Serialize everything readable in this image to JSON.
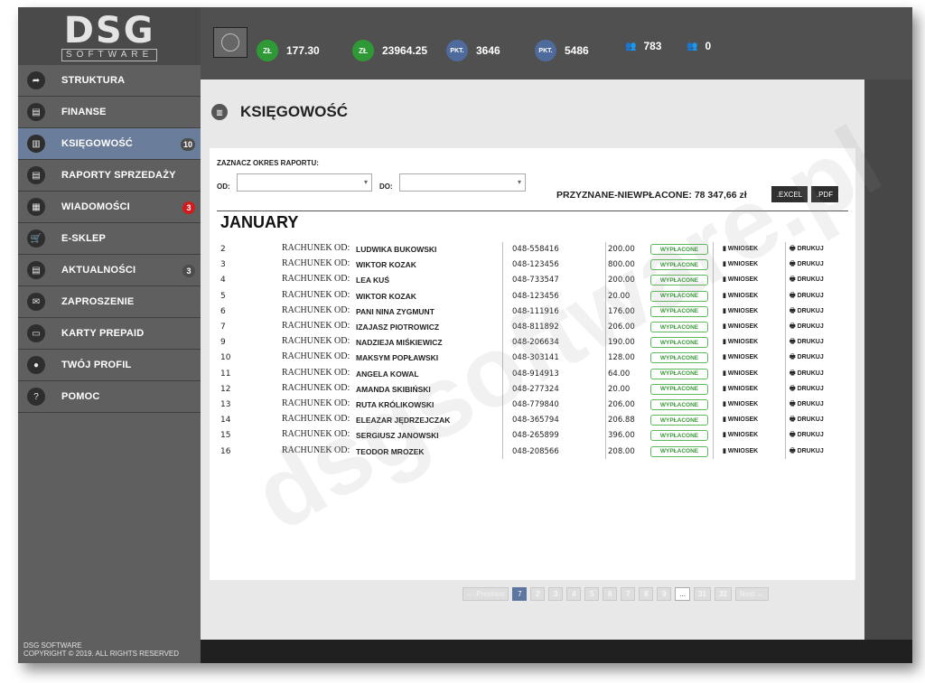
{
  "brand": {
    "name": "DSG",
    "sub": "SOFTWARE"
  },
  "sidebar": {
    "items": [
      {
        "label": "STRUKTURA",
        "icon": "arrow-icon",
        "glyph": "➦"
      },
      {
        "label": "FINANSE",
        "icon": "document-icon",
        "glyph": "▤"
      },
      {
        "label": "KSIĘGOWOŚĆ",
        "icon": "chart-bars-icon",
        "glyph": "▥",
        "badge": "10",
        "active": true
      },
      {
        "label": "RAPORTY SPRZEDAŻY",
        "icon": "report-icon",
        "glyph": "▤"
      },
      {
        "label": "WIADOMOŚCI",
        "icon": "message-icon",
        "glyph": "▦",
        "badge": "3",
        "badge_color": "red"
      },
      {
        "label": "E-SKLEP",
        "icon": "cart-icon",
        "glyph": "🛒"
      },
      {
        "label": "AKTUALNOŚCI",
        "icon": "news-icon",
        "glyph": "▤",
        "badge": "3"
      },
      {
        "label": "ZAPROSZENIE",
        "icon": "invite-icon",
        "glyph": "✉"
      },
      {
        "label": "KARTY PREPAID",
        "icon": "card-icon",
        "glyph": "▭"
      },
      {
        "label": "TWÓJ PROFIL",
        "icon": "profile-icon",
        "glyph": "●"
      },
      {
        "label": "POMOC",
        "icon": "help-icon",
        "glyph": "?"
      }
    ],
    "footer_line1": "DSG SOFTWARE",
    "footer_line2": "COPYRIGHT © 2019. ALL RIGHTS RESERVED"
  },
  "topbar": {
    "stats": [
      {
        "currency": "ZŁ",
        "value": "177.30"
      },
      {
        "currency": "ZŁ",
        "value": "23964.25"
      },
      {
        "currency": "PKT.",
        "value": "3646"
      },
      {
        "currency": "PKT.",
        "value": "5486"
      },
      {
        "people": "👥",
        "value": "783"
      },
      {
        "people": "👥",
        "value": "0"
      }
    ]
  },
  "page": {
    "title": "KSIĘGOWOŚĆ",
    "period_label": "ZAZNACZ OKRES RAPORTU:",
    "od_label": "OD:",
    "do_label": "DO:",
    "summary": "PRZYZNANE-NIEWPŁACONE: 78 347,66 zł",
    "excel_label": ".EXCEL",
    "pdf_label": ".PDF",
    "month": "JANUARY",
    "colors": {
      "accent": "#5d76a0",
      "status_green": "#5cb85c"
    }
  },
  "table": {
    "prefix": "RACHUNEK OD:",
    "status_label": "WYPŁACONE",
    "wniosek_label": "WNIOSEK",
    "drukuj_label": "DRUKUJ",
    "rows": [
      {
        "no": "2",
        "name": "LUDWIKA BUKOWSKI",
        "tel": "048-558416",
        "amount": "200.00"
      },
      {
        "no": "3",
        "name": "WIKTOR KOZAK",
        "tel": "048-123456",
        "amount": "800.00"
      },
      {
        "no": "4",
        "name": "LEA KUŚ",
        "tel": "048-733547",
        "amount": "200.00"
      },
      {
        "no": "5",
        "name": "WIKTOR KOZAK",
        "tel": "048-123456",
        "amount": "20.00"
      },
      {
        "no": "6",
        "name": "PANI NINA ZYGMUNT",
        "tel": "048-111916",
        "amount": "176.00"
      },
      {
        "no": "7",
        "name": "IZAJASZ PIOTROWICZ",
        "tel": "048-811892",
        "amount": "206.00"
      },
      {
        "no": "9",
        "name": "NADZIEJA MIŚKIEWICZ",
        "tel": "048-206634",
        "amount": "190.00"
      },
      {
        "no": "10",
        "name": "MAKSYM POPŁAWSKI",
        "tel": "048-303141",
        "amount": "128.00"
      },
      {
        "no": "11",
        "name": "ANGELA KOWAL",
        "tel": "048-914913",
        "amount": "64.00"
      },
      {
        "no": "12",
        "name": "AMANDA SKIBIŃSKI",
        "tel": "048-277324",
        "amount": "20.00"
      },
      {
        "no": "13",
        "name": "RUTA KRÓLIKOWSKI",
        "tel": "048-779840",
        "amount": "206.00"
      },
      {
        "no": "14",
        "name": "ELEAZAR JĘDRZEJCZAK",
        "tel": "048-365794",
        "amount": "206.88"
      },
      {
        "no": "15",
        "name": "SERGIUSZ JANOWSKI",
        "tel": "048-265899",
        "amount": "396.00"
      },
      {
        "no": "16",
        "name": "TEODOR MROZEK",
        "tel": "048-208566",
        "amount": "208.00"
      }
    ]
  },
  "pagination": {
    "previous": "← Previous",
    "pages": [
      "7",
      "2",
      "3",
      "4",
      "5",
      "6",
      "7",
      "8",
      "9",
      "...",
      "31",
      "32"
    ],
    "active_index": 0,
    "next": "Next →"
  },
  "watermark": "dsgsoftware.pl"
}
